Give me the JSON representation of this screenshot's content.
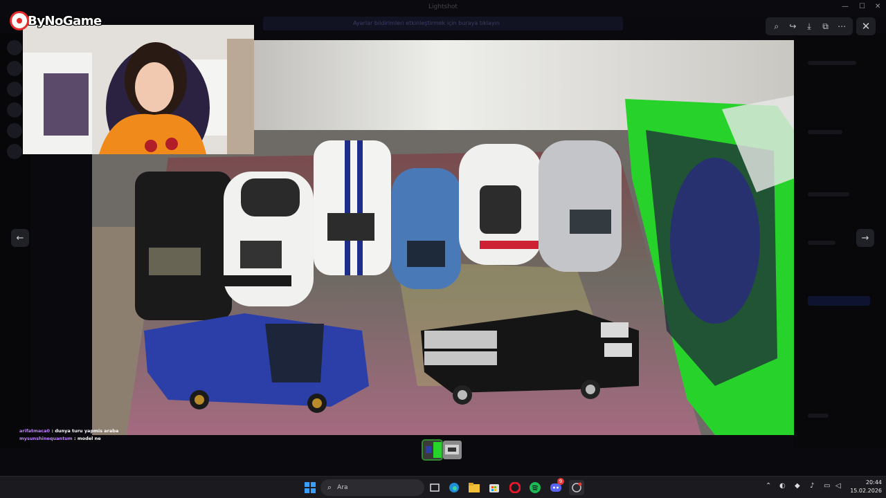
{
  "window": {
    "title": "Lightshot",
    "banner_text": "Ayarlar bildirimleri etkinleştirmek için buraya tıklayın"
  },
  "brand": {
    "name": "ByNoGame"
  },
  "viewer": {
    "toolbar": [
      {
        "name": "zoom-icon",
        "glyph": "⌕"
      },
      {
        "name": "forward-icon",
        "glyph": "↪"
      },
      {
        "name": "download-icon",
        "glyph": "⤓"
      },
      {
        "name": "open-external-icon",
        "glyph": "⧉"
      },
      {
        "name": "more-icon",
        "glyph": "⋯"
      }
    ],
    "close_glyph": "✕",
    "prev_glyph": "←",
    "next_glyph": "→"
  },
  "chat": {
    "messages": [
      {
        "user": "arifatmaca0",
        "text": ": dunya turu yapmis araba"
      },
      {
        "user": "mysunshinequantum",
        "text": ": model ne"
      }
    ]
  },
  "taskbar": {
    "search_placeholder": "Ara",
    "clock_time": "20:44",
    "clock_date": "15.02.2026",
    "discord_badge": "9"
  },
  "colors": {
    "accent_green": "#2ecc2e",
    "brand_red": "#e52b2b",
    "chat_user": "#c080ff"
  }
}
